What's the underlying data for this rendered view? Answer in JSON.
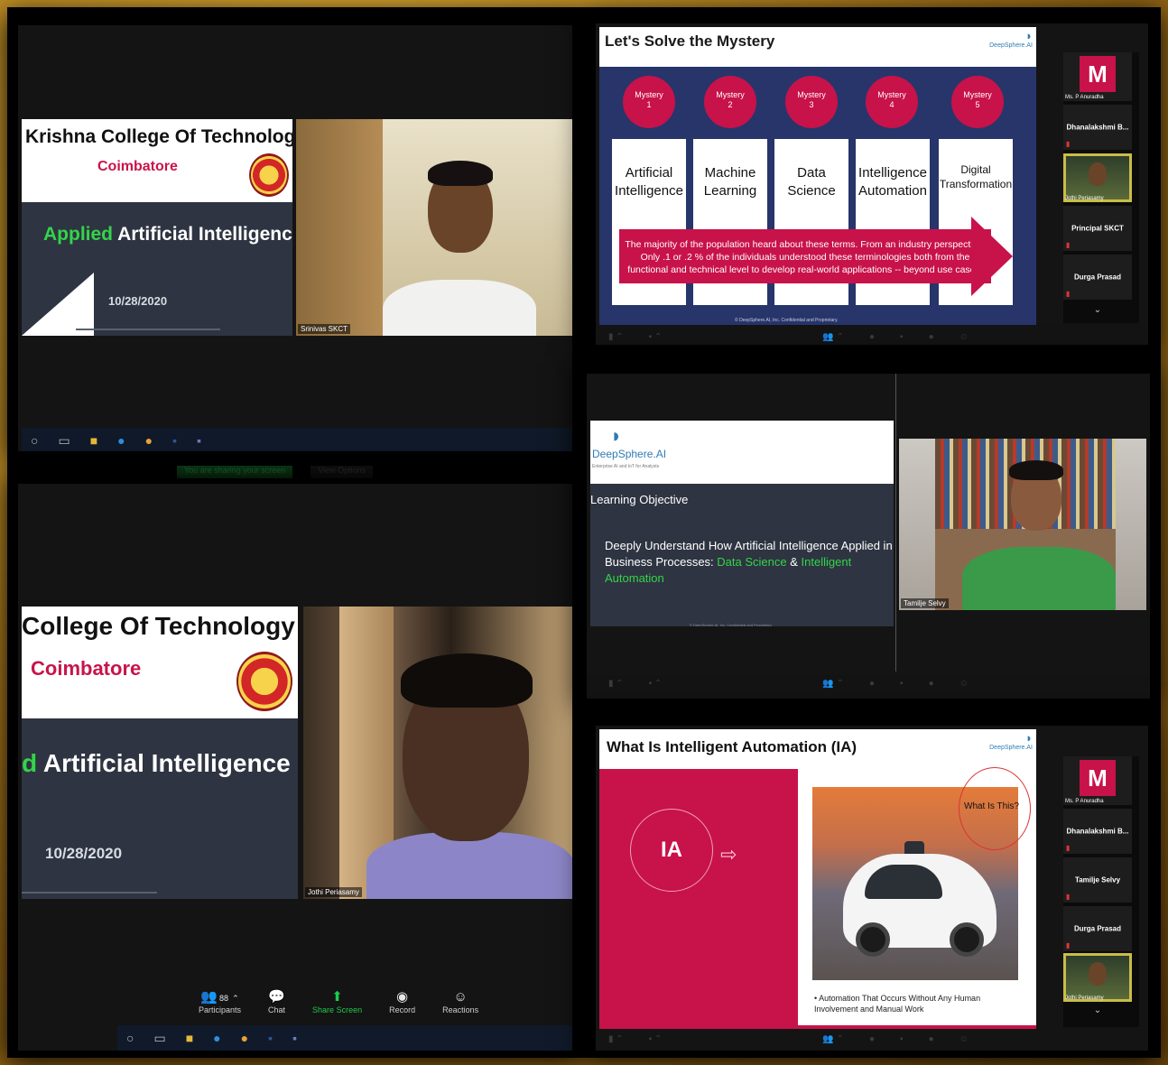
{
  "panels": {
    "top_left": {
      "slide": {
        "college_name": "Krishna College Of Technology",
        "city": "Coimbatore",
        "title_prefix": "Applied",
        "title_rest": "Artificial Intelligence",
        "date": "10/28/2020"
      },
      "camera_name": "Srinivas SKCT"
    },
    "top_right": {
      "slide": {
        "title": "Let's Solve the Mystery",
        "logo_text": "DeepSphere.AI",
        "mysteries": [
          {
            "badge": "Mystery\n1",
            "term": "Artificial Intelligence"
          },
          {
            "badge": "Mystery\n2",
            "term": "Machine Learning"
          },
          {
            "badge": "Mystery\n3",
            "term": "Data Science"
          },
          {
            "badge": "Mystery\n4",
            "term": "Intelligence Automation"
          },
          {
            "badge": "Mystery\n5",
            "term": "Digital Transformation"
          }
        ],
        "arrow_text": "The majority of the population heard about these terms. From an industry perspective, Only .1 or .2 % of the individuals understood these terminologies both from the functional and technical level to develop real-world applications -- beyond use cases."
      },
      "participants": [
        {
          "name": "Ms. P Anuradha",
          "avatar": "M"
        },
        {
          "name": "Dhanalakshmi B..."
        },
        {
          "name": "Jothi Periasamy"
        },
        {
          "name": "Principal SKCT"
        },
        {
          "name": "Durga Prasad"
        }
      ]
    },
    "bottom_left": {
      "slide": {
        "college_name": "College Of Technology",
        "city": "Coimbatore",
        "title_prefix": "d",
        "title_rest": "Artificial Intelligence",
        "date": "10/28/2020"
      },
      "camera_name": "Jothi Periasamy",
      "toolbar": {
        "participants_count": "88",
        "items": [
          "Participants",
          "Chat",
          "Share Screen",
          "Record",
          "Reactions"
        ]
      },
      "taskbar_top": {
        "share_text": "You are sharing your screen",
        "view_options": "View Options"
      }
    },
    "middle_right": {
      "slide": {
        "logo_text": "DeepSphere.AI",
        "tagline": "Enterprise AI and IoT for Analysts",
        "title": "Learning Objective",
        "body_lead": "Deeply Understand How Artificial Intelligence Applied in Business Processes:",
        "body_ds": "Data Science",
        "body_and": "&",
        "body_ia": "Intelligent Automation"
      },
      "camera_name": "Tamilje Selvy"
    },
    "bottom_right": {
      "slide": {
        "title": "What Is Intelligent Automation (IA)",
        "ia": "IA",
        "callout": "What Is This?",
        "bullet": "Automation That Occurs Without Any Human Involvement and Manual Work"
      },
      "participants": [
        {
          "name": "Ms. P Anuradha",
          "avatar": "M"
        },
        {
          "name": "Dhanalakshmi B..."
        },
        {
          "name": "Tamilje Selvy"
        },
        {
          "name": "Durga Prasad"
        },
        {
          "name": "Jothi Periasamy"
        }
      ]
    }
  },
  "colors": {
    "brand_red": "#c8124a",
    "zoom_green": "#1fc94c",
    "slide_dark": "#2e3441",
    "mystery_blue": "#27356b"
  }
}
